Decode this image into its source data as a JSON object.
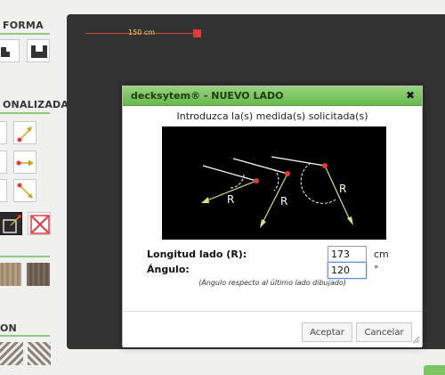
{
  "sidebar": {
    "sections": [
      {
        "title": "FORMA"
      },
      {
        "title": "ONALIZADA"
      },
      {
        "title": "ON"
      }
    ]
  },
  "canvas": {
    "slider_label": "150 cm"
  },
  "modal": {
    "title": "decksytem® - NUEVO LADO",
    "close_icon": "✖",
    "subtitle": "Introduzca la(s) medida(s) solicitada(s)",
    "diagram_labels": [
      "R",
      "R",
      "R"
    ],
    "fields": [
      {
        "label": "Longitud lado (R):",
        "value": "173",
        "unit": "cm"
      },
      {
        "label": "Ángulo:",
        "value": "120",
        "unit": "°"
      }
    ],
    "note": "(Ángulo respecto al último lado dibujado)",
    "buttons": {
      "accept": "Aceptar",
      "cancel": "Cancelar"
    }
  },
  "colors": {
    "accent_green": "#7cc563",
    "canvas_bg": "#333333",
    "marker_red": "#e23a3a",
    "arrow_yellow": "#d4e67a"
  }
}
